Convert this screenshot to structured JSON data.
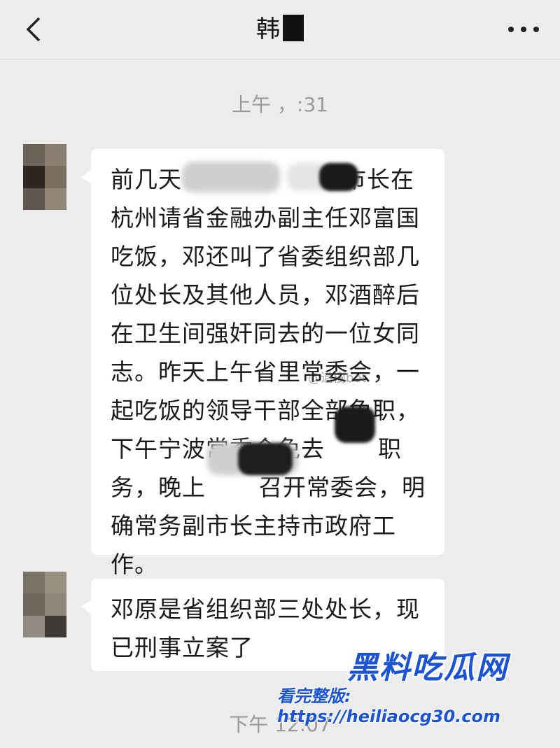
{
  "header": {
    "title": "韩",
    "back_icon": "chevron-left-icon",
    "more_icon": "more-dots-icon"
  },
  "messages": [
    {
      "timestamp": "上午 ，:31",
      "lines": [
        "前几天",
        "市长在",
        "杭州请省金融办副主任邓富国",
        "吃饭，邓还叫了省委组织部几",
        "位处长及其他人员，邓酒醉后",
        "在卫生间强奸同去的一位女同",
        "志。昨天上午省里常委会，一",
        "起吃饭的领导干部全部免职，",
        "下午宁波常委会免去",
        "职",
        "务，晚上",
        "召开常委会，明",
        "确常务副市长主持市政府工",
        "作。"
      ]
    },
    {
      "lines": [
        "邓原是省组织部三处处长，现",
        "已刑事立案了"
      ],
      "timestamp": "下午 12:07"
    }
  ],
  "watermark": "@道樹bot",
  "promo": {
    "title": "黑料吃瓜网",
    "url": "看完整版: https://heiliaocg30.com"
  },
  "colors": {
    "background": "#ececec",
    "bubble": "#ffffff",
    "promo": "#1a53d6"
  }
}
